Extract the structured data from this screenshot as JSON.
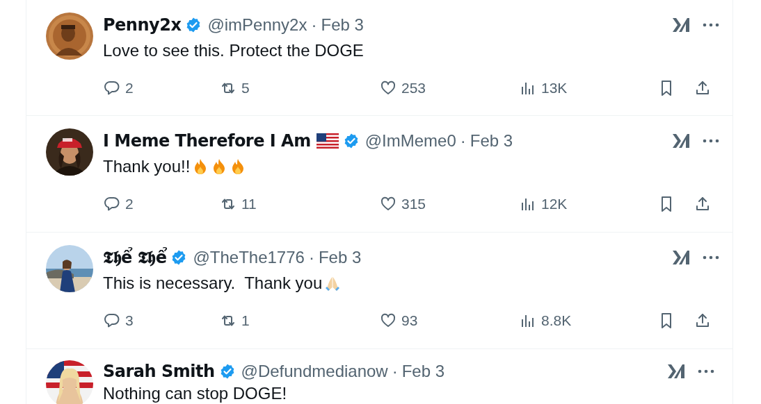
{
  "posts": [
    {
      "name": "Penny2x",
      "verified": true,
      "flag": false,
      "handle": "@imPenny2x",
      "separator": "·",
      "time": "Feb 3",
      "text": "Love to see this. Protect the DOGE",
      "replies": "2",
      "reposts": "5",
      "likes": "253",
      "views": "13K"
    },
    {
      "name": "I Meme Therefore I Am",
      "verified": true,
      "flag": true,
      "handle": "@ImMeme0",
      "separator": "·",
      "time": "Feb 3",
      "text": "Thank you!!",
      "emoji": [
        {
          "kind": "fire"
        },
        {
          "kind": "fire"
        },
        {
          "kind": "fire"
        }
      ],
      "replies": "2",
      "reposts": "11",
      "likes": "315",
      "views": "12K"
    },
    {
      "name": "𝕿𝖍ể 𝕿𝖍ể",
      "verified": true,
      "flag": false,
      "handle": "@TheThe1776",
      "separator": "·",
      "time": "Feb 3",
      "text": "This is necessary.  Thank you",
      "emoji": [
        {
          "kind": "pray"
        }
      ],
      "replies": "3",
      "reposts": "1",
      "likes": "93",
      "views": "8.8K"
    },
    {
      "name": "Sarah Smith",
      "verified": true,
      "flag": false,
      "handle": "@Defundmedianow",
      "separator": "·",
      "time": "Feb 3",
      "text": "Nothing can stop DOGE!"
    }
  ]
}
